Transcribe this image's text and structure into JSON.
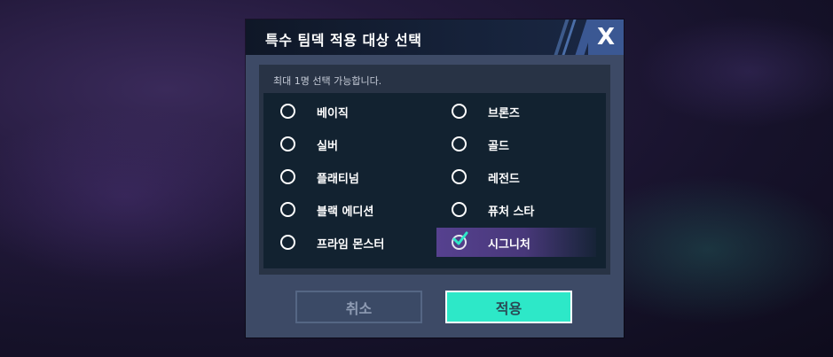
{
  "dialog": {
    "title": "특수 팀덱 적용 대상 선택",
    "close_icon": "close-icon",
    "instruction": "최대 1명 선택 가능합니다.",
    "options": [
      {
        "label": "베이직",
        "selected": false
      },
      {
        "label": "브론즈",
        "selected": false
      },
      {
        "label": "실버",
        "selected": false
      },
      {
        "label": "골드",
        "selected": false
      },
      {
        "label": "플래티넘",
        "selected": false
      },
      {
        "label": "레전드",
        "selected": false
      },
      {
        "label": "블랙 에디션",
        "selected": false
      },
      {
        "label": "퓨처 스타",
        "selected": false
      },
      {
        "label": "프라임 몬스터",
        "selected": false
      },
      {
        "label": "시그니처",
        "selected": true
      }
    ],
    "cancel_label": "취소",
    "apply_label": "적용",
    "close_label": "X"
  },
  "colors": {
    "accent_apply": "#2de8c8",
    "selected_highlight": "#56418f",
    "title_bar": "#0f1727",
    "close_button": "#3b5893"
  }
}
